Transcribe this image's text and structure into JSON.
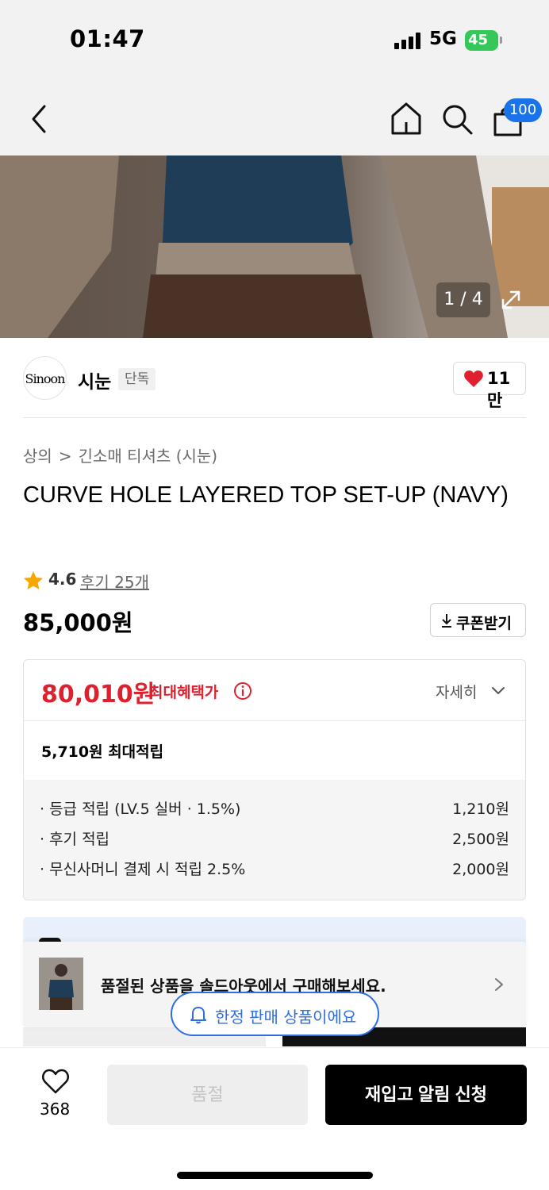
{
  "status_bar": {
    "time": "01:47",
    "network": "5G",
    "battery": "45"
  },
  "nav": {
    "cart_badge": "100"
  },
  "gallery": {
    "counter": "1 / 4"
  },
  "brand": {
    "logo_text": "Sinoon",
    "name": "시눈",
    "tag": "단독",
    "likes": "11만"
  },
  "breadcrumb": {
    "category": "상의",
    "separator": ">",
    "subcategory": "긴소매 티셔츠 (시눈)"
  },
  "product": {
    "title": "CURVE HOLE LAYERED TOP SET-UP (NAVY)",
    "rating": "4.6",
    "review_link": "후기 25개",
    "price": "85,000원",
    "coupon_label": "쿠폰받기"
  },
  "benefit": {
    "price": "80,010원",
    "label": "최대혜택가",
    "detail_label": "자세히",
    "points_total": "5,710원 최대적립",
    "points": [
      {
        "label": "· 등급 적립 (LV.5 실버 · 1.5%)",
        "amount": "1,210원"
      },
      {
        "label": "· 후기 적립",
        "amount": "2,500원"
      },
      {
        "label": "· 무신사머니 결제 시 적립 2.5%",
        "amount": "2,000원"
      }
    ]
  },
  "soldout_banner": {
    "text": "품절된 상품을 솔드아웃에서 구매해보세요."
  },
  "limited_pill": {
    "text": "한정 판매 상품이에요"
  },
  "bottom_bar": {
    "wish_count": "368",
    "soldout_label": "품절",
    "restock_label": "재입고 알림 신청"
  },
  "colors": {
    "accent_red": "#e0202e",
    "accent_blue": "#2f6ee0",
    "badge_blue": "#1a73e8",
    "battery_green": "#35c759"
  },
  "icons": [
    "back-icon",
    "home-icon",
    "search-icon",
    "cart-icon",
    "expand-icon",
    "heart-icon",
    "star-icon",
    "download-icon",
    "info-icon",
    "chevron-down-icon",
    "chevron-right-icon",
    "bell-icon",
    "heart-outline-icon"
  ]
}
